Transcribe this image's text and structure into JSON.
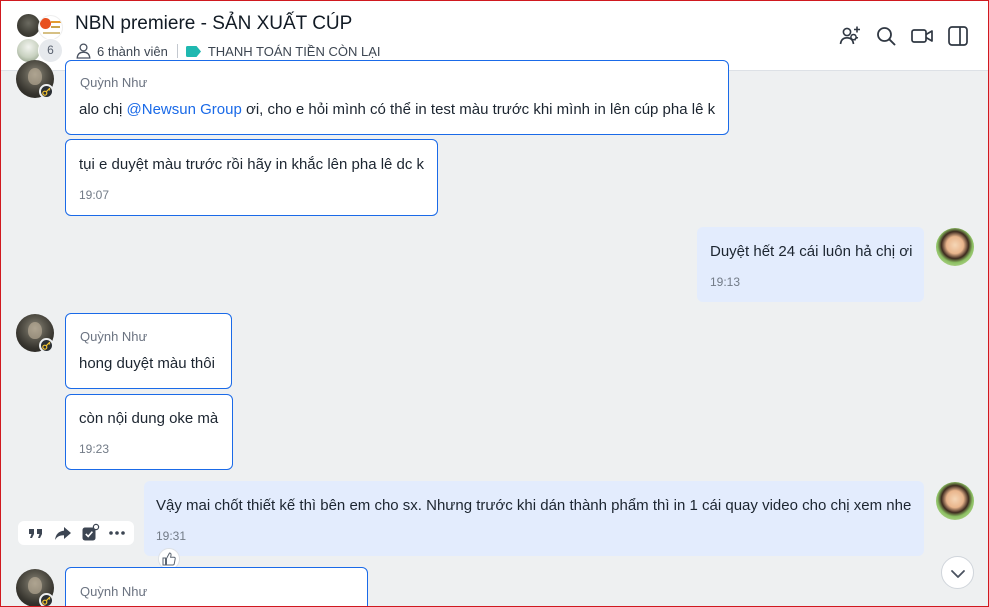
{
  "header": {
    "group_name": "NBN premiere - SẢN XUẤT CÚP",
    "avatar_extra_count": "6",
    "member_count_label": "6 thành viên",
    "tag_label": "THANH TOÁN TIỀN CÒN LẠI",
    "tag_color": "#1fb8b0",
    "actions": [
      "add-member-icon",
      "search-icon",
      "video-call-icon",
      "sidebar-toggle-icon"
    ]
  },
  "messages": [
    {
      "sender": "Quỳnh Như",
      "text_before": "alo chị ",
      "mention": "@Newsun Group",
      "text_after": " ơi, cho e hỏi mình có thể in test màu trước khi mình in lên cúp pha lê k"
    },
    {
      "text": "tụi e duyệt màu trước rồi hãy in khắc lên pha lê dc k",
      "time": "19:07"
    },
    {
      "text": "Duyệt hết 24 cái luôn hả chị ơi",
      "time": "19:13"
    },
    {
      "sender": "Quỳnh Như",
      "text": "hong duyệt màu thôi"
    },
    {
      "text": "còn nội dung oke mà",
      "time": "19:23"
    },
    {
      "text": "Vậy mai chốt thiết kế thì bên em cho sx. Nhưng trước khi dán thành phẩm thì in 1 cái quay video cho chị xem nhe",
      "time": "19:31"
    },
    {
      "sender": "Quỳnh Như"
    }
  ],
  "message_actions": [
    "quote-icon",
    "forward-icon",
    "create-task-icon",
    "more-icon"
  ],
  "colors": {
    "accent": "#1a6ae8",
    "outgoing_bubble": "#e3ecfd",
    "chat_background": "#eef0f1"
  }
}
